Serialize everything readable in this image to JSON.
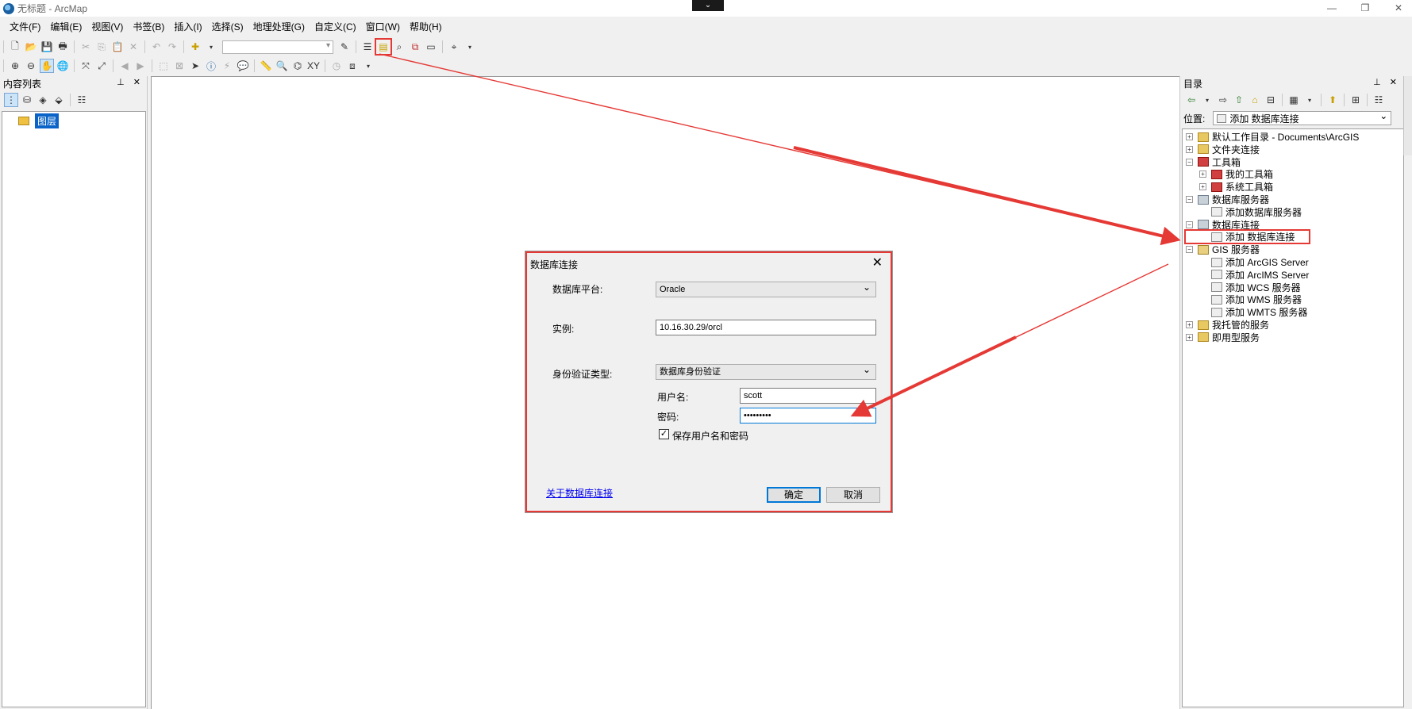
{
  "window": {
    "title": "无标题 - ArcMap",
    "collapse_glyph": "⌄",
    "minimize": "—",
    "restore": "❐",
    "close": "✕"
  },
  "menu": [
    "文件(F)",
    "编辑(E)",
    "视图(V)",
    "书签(B)",
    "插入(I)",
    "选择(S)",
    "地理处理(G)",
    "自定义(C)",
    "窗口(W)",
    "帮助(H)"
  ],
  "toc": {
    "title": "内容列表",
    "pin_close": "⊥ ✕",
    "layer": "图层"
  },
  "catalog": {
    "title": "目录",
    "pin_close": "⊥ ✕",
    "location_label": "位置:",
    "location_value": "添加 数据库连接",
    "tree": [
      {
        "label": "默认工作目录 - Documents\\ArcGIS",
        "exp": "+",
        "icon": "folder"
      },
      {
        "label": "文件夹连接",
        "exp": "+",
        "icon": "folder"
      },
      {
        "label": "工具箱",
        "exp": "−",
        "icon": "red"
      },
      {
        "label": "我的工具箱",
        "exp": "+",
        "icon": "red"
      },
      {
        "label": "系统工具箱",
        "exp": "+",
        "icon": "red"
      },
      {
        "label": "数据库服务器",
        "exp": "−",
        "icon": "db"
      },
      {
        "label": "添加数据库服务器",
        "exp": "",
        "icon": "add"
      },
      {
        "label": "数据库连接",
        "exp": "−",
        "icon": "db"
      },
      {
        "label": "添加 数据库连接",
        "exp": "",
        "icon": "add"
      },
      {
        "label": "GIS 服务器",
        "exp": "−",
        "icon": "gis"
      },
      {
        "label": "添加 ArcGIS Server",
        "exp": "",
        "icon": "add"
      },
      {
        "label": "添加 ArcIMS Server",
        "exp": "",
        "icon": "add"
      },
      {
        "label": "添加 WCS 服务器",
        "exp": "",
        "icon": "add"
      },
      {
        "label": "添加 WMS 服务器",
        "exp": "",
        "icon": "add"
      },
      {
        "label": "添加 WMTS 服务器",
        "exp": "",
        "icon": "add"
      },
      {
        "label": "我托管的服务",
        "exp": "+",
        "icon": "folder"
      },
      {
        "label": "即用型服务",
        "exp": "+",
        "icon": "folder"
      }
    ]
  },
  "dialog": {
    "title": "数据库连接",
    "close": "✕",
    "platform_label": "数据库平台:",
    "platform_value": "Oracle",
    "instance_label": "实例:",
    "instance_value": "10.16.30.29/orcl",
    "auth_label": "身份验证类型:",
    "auth_value": "数据库身份验证",
    "username_label": "用户名:",
    "username_value": "scott",
    "password_label": "密码:",
    "password_value": "•••••••••",
    "save_label": "保存用户名和密码",
    "save_checked": "✓",
    "about_link": "关于数据库连接",
    "ok": "确定",
    "cancel": "取消"
  },
  "colors": {
    "annotation_red": "#e53935",
    "selection_blue": "#0a64c8"
  }
}
